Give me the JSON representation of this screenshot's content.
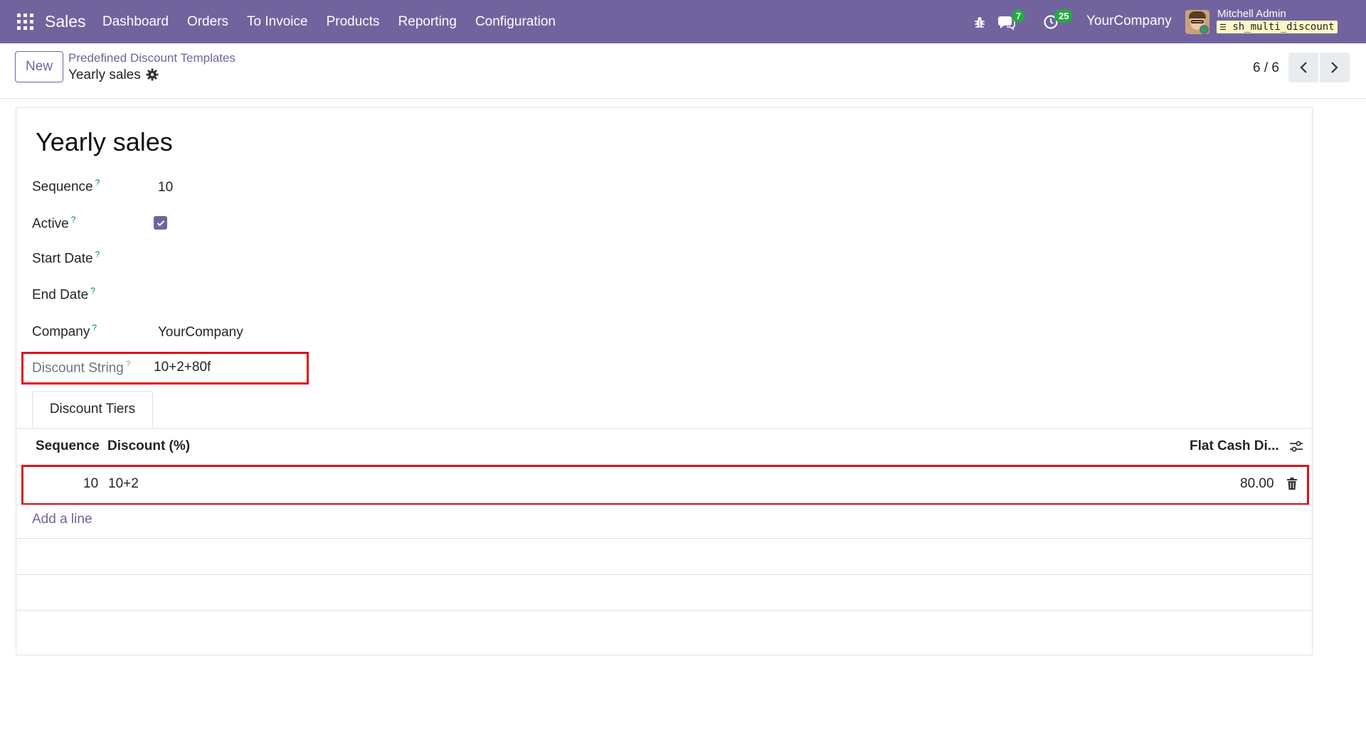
{
  "navbar": {
    "app_name": "Sales",
    "menu": [
      "Dashboard",
      "Orders",
      "To Invoice",
      "Products",
      "Reporting",
      "Configuration"
    ],
    "chat_count": "7",
    "activity_count": "25",
    "company": "YourCompany",
    "user_name": "Mitchell Admin",
    "database": "sh_multi_discount",
    "accent_color": "#71639e"
  },
  "control": {
    "new_label": "New",
    "breadcrumb_parent": "Predefined Discount Templates",
    "breadcrumb_current": "Yearly sales",
    "pager": "6 / 6"
  },
  "form": {
    "title": "Yearly sales",
    "fields": {
      "sequence": {
        "label": "Sequence",
        "help": "?",
        "value": "10"
      },
      "active": {
        "label": "Active",
        "help": "?",
        "checked": true
      },
      "start_date": {
        "label": "Start Date",
        "help": "?",
        "value": ""
      },
      "end_date": {
        "label": "End Date",
        "help": "?",
        "value": ""
      },
      "company": {
        "label": "Company",
        "help": "?",
        "value": "YourCompany"
      },
      "discount_string": {
        "label": "Discount String",
        "help": "?",
        "value": "10+2+80f"
      }
    },
    "tabs": [
      "Discount Tiers"
    ],
    "table": {
      "columns": [
        "Sequence",
        "Discount (%)",
        "Flat Cash Di..."
      ],
      "rows": [
        {
          "sequence": "10",
          "discount": "10+2",
          "flat_cash": "80.00"
        }
      ],
      "add_line": "Add a line"
    }
  },
  "icons": [
    "apps-icon",
    "bug-icon",
    "chat-icon",
    "clock-icon",
    "gear-icon",
    "chevron-left-icon",
    "chevron-right-icon",
    "checkmark-icon",
    "column-settings-icon",
    "trash-icon"
  ],
  "highlight_color": "#e0101a"
}
